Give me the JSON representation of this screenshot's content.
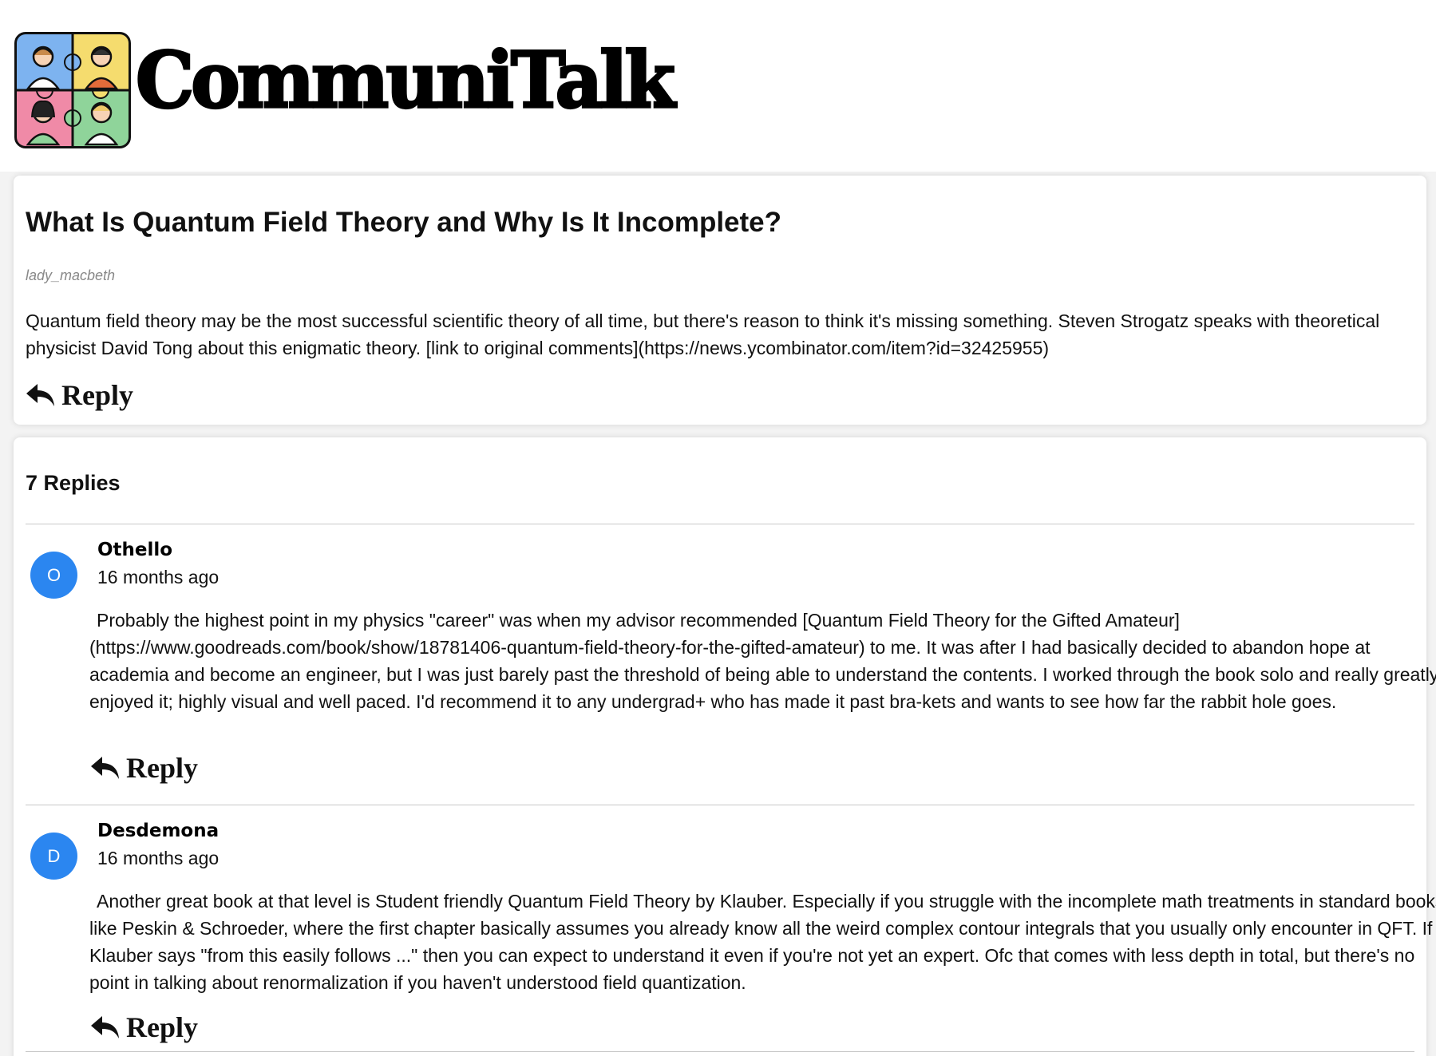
{
  "brand": {
    "name": "CommuniTalk",
    "logo_icon": "puzzle-people-icon",
    "colors": {
      "tile_blue": "#7db3f0",
      "tile_yellow": "#f5dc6e",
      "tile_pink": "#f08aa7",
      "tile_green": "#8fd49a"
    }
  },
  "post": {
    "title": "What Is Quantum Field Theory and Why Is It Incomplete?",
    "author": "lady_macbeth",
    "body": "Quantum field theory may be the most successful scientific theory of all time, but there's reason to think it's missing something. Steven Strogatz speaks with theoretical physicist David Tong about this enigmatic theory. [link to original comments](https://news.ycombinator.com/item?id=32425955)",
    "reply_label": "Reply"
  },
  "replies": {
    "count_label": "7 Replies",
    "items": [
      {
        "avatar_letter": "O",
        "author": "Othello",
        "time": "16 months ago",
        "body": "Probably the highest point in my physics \"career\" was when my advisor recommended [Quantum Field Theory for the Gifted Amateur](https://www.goodreads.com/book/show/18781406-quantum-field-theory-for-the-gifted-amateur) to me. It was after I had basically decided to abandon hope at academia and become an engineer, but I was just barely past the threshold of being able to understand the contents. I worked through the book solo and really greatly enjoyed it; highly visual and well paced. I'd recommend it to any undergrad+ who has made it past bra-kets and wants to see how far the rabbit hole goes.",
        "reply_label": "Reply"
      },
      {
        "avatar_letter": "D",
        "author": "Desdemona",
        "time": "16 months ago",
        "body": "Another great book at that level is Student friendly Quantum Field Theory by Klauber. Especially if you struggle with the incomplete math treatments in standard books like Peskin & Schroeder, where the first chapter basically assumes you already know all the weird complex contour integrals that you usually only encounter in QFT. If Klauber says \"from this easily follows ...\" then you can expect to understand it even if you're not yet an expert. Ofc that comes with less depth in total, but there's no point in talking about renormalization if you haven't understood field quantization.",
        "reply_label": "Reply"
      }
    ]
  },
  "icons": {
    "reply": "reply-arrow-icon"
  },
  "colors": {
    "avatar": "#2b86f0",
    "author_meta": "#888888"
  }
}
